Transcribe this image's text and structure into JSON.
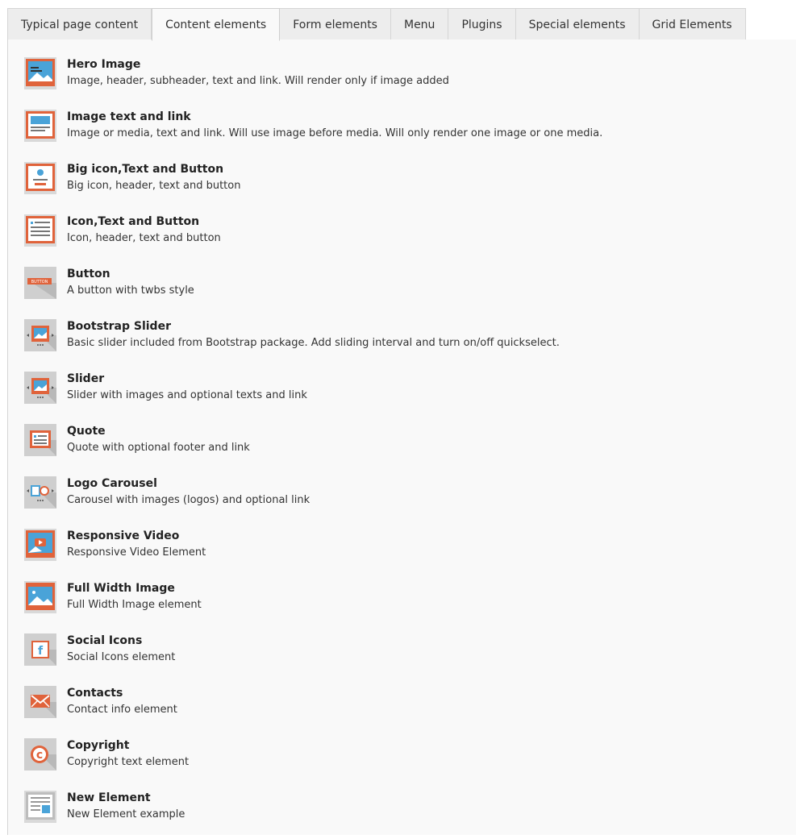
{
  "tabs": [
    {
      "label": "Typical page content"
    },
    {
      "label": "Content elements"
    },
    {
      "label": "Form elements"
    },
    {
      "label": "Menu"
    },
    {
      "label": "Plugins"
    },
    {
      "label": "Special elements"
    },
    {
      "label": "Grid Elements"
    }
  ],
  "active_tab": "Content elements",
  "colors": {
    "accent": "#e0633b",
    "icon_bg": "#c9c9c9",
    "icon_blue": "#4aa3d8"
  },
  "items": [
    {
      "title": "Hero Image",
      "desc": "Image, header, subheader, text and link. Will render only if image added",
      "icon": "hero-image-icon"
    },
    {
      "title": "Image text and link",
      "desc": "Image or media, text and link. Will use image before media. Will only render one image or one media.",
      "icon": "image-text-link-icon"
    },
    {
      "title": "Big icon,Text and Button",
      "desc": "Big icon, header, text and button",
      "icon": "big-icon-text-button-icon"
    },
    {
      "title": "Icon,Text and Button",
      "desc": "Icon, header, text and button",
      "icon": "icon-text-button-icon"
    },
    {
      "title": "Button",
      "desc": "A button with twbs style",
      "icon": "button-icon",
      "icon_text": "BUTTON"
    },
    {
      "title": "Bootstrap Slider",
      "desc": "Basic slider included from Bootstrap package. Add sliding interval and turn on/off quickselect.",
      "icon": "bootstrap-slider-icon"
    },
    {
      "title": "Slider",
      "desc": "Slider with images and optional texts and link",
      "icon": "slider-icon"
    },
    {
      "title": "Quote",
      "desc": "Quote with optional footer and link",
      "icon": "quote-icon"
    },
    {
      "title": "Logo Carousel",
      "desc": "Carousel with images (logos) and optional link",
      "icon": "logo-carousel-icon"
    },
    {
      "title": "Responsive Video",
      "desc": "Responsive Video Element",
      "icon": "responsive-video-icon"
    },
    {
      "title": "Full Width Image",
      "desc": "Full Width Image element",
      "icon": "full-width-image-icon"
    },
    {
      "title": "Social Icons",
      "desc": "Social Icons element",
      "icon": "social-icons-icon",
      "icon_text": "f"
    },
    {
      "title": "Contacts",
      "desc": "Contact info element",
      "icon": "contacts-icon"
    },
    {
      "title": "Copyright",
      "desc": "Copyright text element",
      "icon": "copyright-icon",
      "icon_text": "c"
    },
    {
      "title": "New Element",
      "desc": "New Element example",
      "icon": "new-element-icon"
    }
  ]
}
